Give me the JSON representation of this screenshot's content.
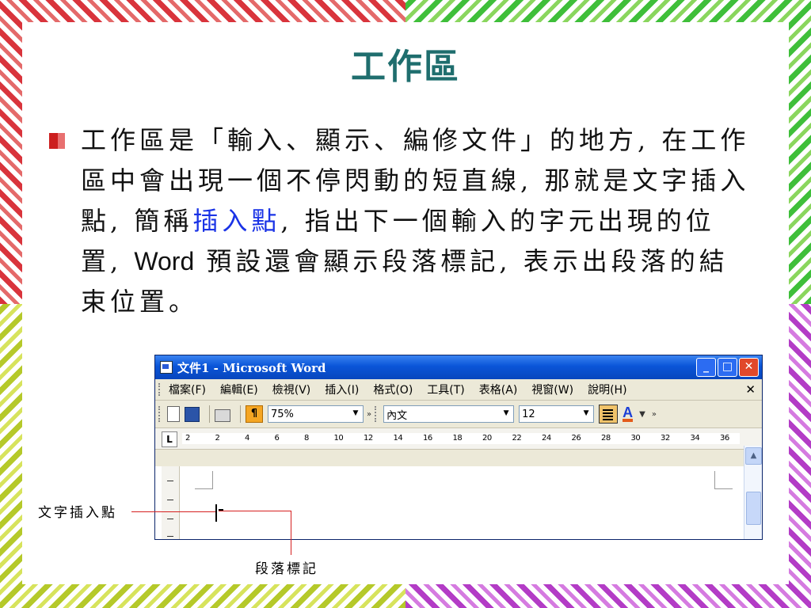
{
  "slide": {
    "title": "工作區",
    "body_part1": "工作區是「輸入、顯示、編修文件」的地方, 在工作區中會出現一個不停閃動的短直線, 那就是文字插入點, 簡稱",
    "highlight": "插入點",
    "body_part2": ", 指出下一個輸入的字元出現的位置, ",
    "body_latin": "Word",
    "body_part3": " 預設還會顯示段落標記, 表示出段落的結束位置。"
  },
  "window": {
    "title": "文件1 - Microsoft Word",
    "controls": {
      "minimize": "_",
      "maximize": "□",
      "close": "✕"
    },
    "menu": [
      "檔案(F)",
      "編輯(E)",
      "檢視(V)",
      "插入(I)",
      "格式(O)",
      "工具(T)",
      "表格(A)",
      "視窗(W)",
      "說明(H)"
    ],
    "menu_close": "✕",
    "toolbar": {
      "zoom": "75%",
      "style": "內文",
      "font_size": "12",
      "font_color_glyph": "A",
      "para_glyph": "¶"
    },
    "ruler": {
      "tab_selector": "L",
      "ticks": [
        "2",
        "2",
        "4",
        "6",
        "8",
        "10",
        "12",
        "14",
        "16",
        "18",
        "20",
        "22",
        "24",
        "26",
        "28",
        "30",
        "32",
        "34",
        "36"
      ]
    },
    "scroll_up": "▲"
  },
  "callouts": {
    "insertion_point": "文字插入點",
    "paragraph_mark": "段落標記"
  },
  "colors": {
    "title": "#1f6e6e",
    "highlight": "#1a33e6",
    "callout_line": "#d62020"
  }
}
